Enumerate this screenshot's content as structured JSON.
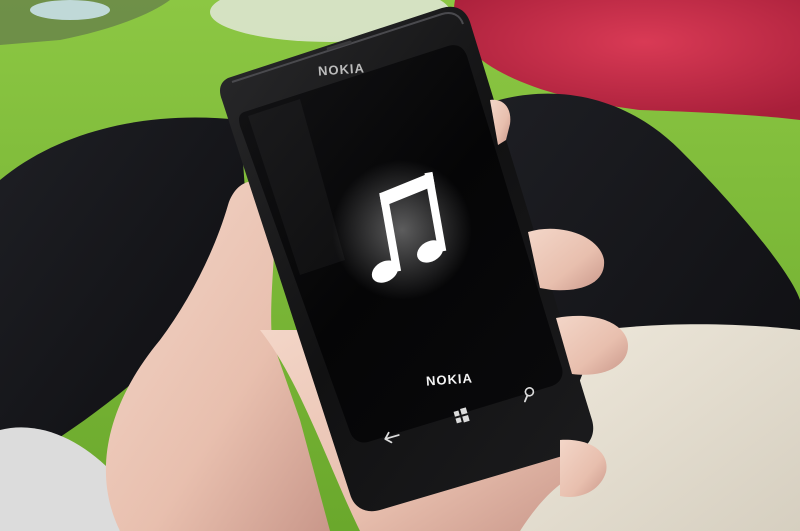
{
  "phone": {
    "brand_top": "NOKIA",
    "brand_screen": "NOKIA"
  },
  "icons": {
    "center": "music-note-icon",
    "search": "search-icon",
    "windows": "windows-start-icon",
    "back": "back-arrow-icon"
  },
  "colors": {
    "background_green": "#7fbf3a",
    "phone_body": "#141414",
    "screen": "#050505",
    "icon_white": "#ffffff"
  }
}
